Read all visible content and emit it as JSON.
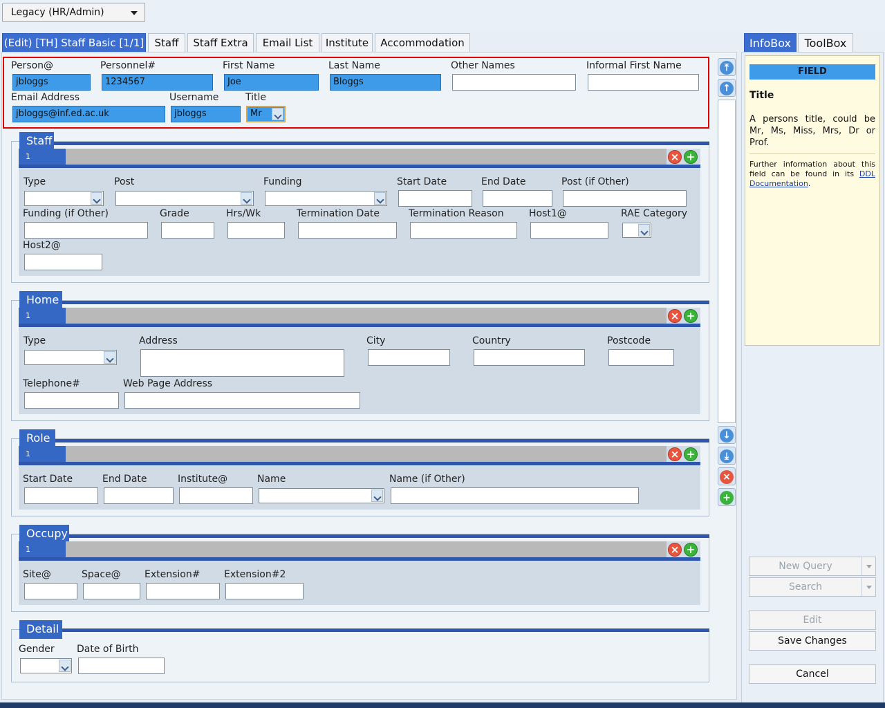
{
  "top": {
    "dropdown_value": "Legacy (HR/Admin)"
  },
  "tabs": [
    {
      "label": "(Edit) [TH] Staff Basic [1/1]"
    },
    {
      "label": "Staff"
    },
    {
      "label": "Staff Extra"
    },
    {
      "label": "Email List"
    },
    {
      "label": "Institute"
    },
    {
      "label": "Accommodation"
    }
  ],
  "basic": {
    "person_label": "Person@",
    "person_value": "jbloggs",
    "personnel_label": "Personnel#",
    "personnel_value": "1234567",
    "first_name_label": "First Name",
    "first_name_value": "Joe",
    "last_name_label": "Last Name",
    "last_name_value": "Bloggs",
    "other_names_label": "Other Names",
    "other_names_value": "",
    "informal_label": "Informal First Name",
    "informal_value": "",
    "email_label": "Email Address",
    "email_value": "jbloggs@inf.ed.ac.uk",
    "username_label": "Username",
    "username_value": "jbloggs",
    "title_label": "Title",
    "title_value": "Mr"
  },
  "staff": {
    "title": "Staff",
    "row": "1",
    "type": "Type",
    "post": "Post",
    "funding": "Funding",
    "start_date": "Start Date",
    "end_date": "End Date",
    "post_other": "Post (if Other)",
    "funding_other": "Funding (if Other)",
    "grade": "Grade",
    "hrs": "Hrs/Wk",
    "term_date": "Termination Date",
    "term_reason": "Termination Reason",
    "host1": "Host1@",
    "rae": "RAE Category",
    "host2": "Host2@"
  },
  "home": {
    "title": "Home",
    "row": "1",
    "type": "Type",
    "address": "Address",
    "city": "City",
    "country": "Country",
    "postcode": "Postcode",
    "telephone": "Telephone#",
    "web": "Web Page Address"
  },
  "role": {
    "title": "Role",
    "row": "1",
    "start_date": "Start Date",
    "end_date": "End Date",
    "institute": "Institute@",
    "name": "Name",
    "name_other": "Name (if Other)"
  },
  "occupy": {
    "title": "Occupy",
    "row": "1",
    "site": "Site@",
    "space": "Space@",
    "ext": "Extension#",
    "ext2": "Extension#2"
  },
  "detail": {
    "title": "Detail",
    "gender": "Gender",
    "dob": "Date of Birth"
  },
  "right": {
    "tab_infobox": "InfoBox",
    "tab_toolbox": "ToolBox",
    "field_header": "FIELD",
    "field_title": "Title",
    "field_desc": "A persons title, could be Mr, Ms, Miss, Mrs, Dr or Prof.",
    "further_text": "Further information about this field can be found in its",
    "ddl_link": "DDL Documentation",
    "new_query": "New Query",
    "search": "Search",
    "edit": "Edit",
    "save": "Save Changes",
    "cancel": "Cancel"
  }
}
